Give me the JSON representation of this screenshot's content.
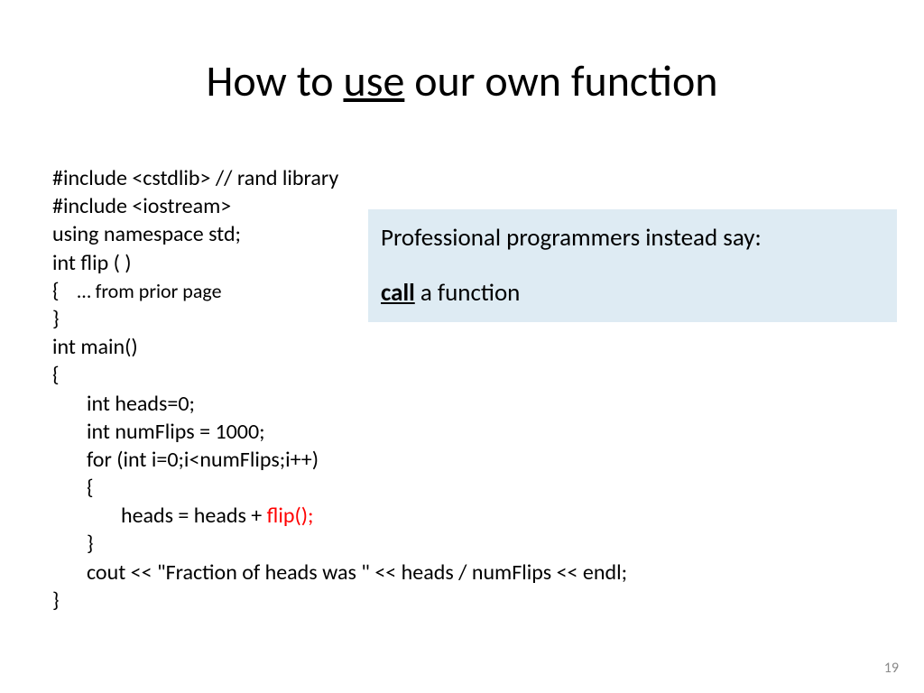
{
  "title": {
    "pre": "How to ",
    "underlined": "use",
    "post": " our own function"
  },
  "code": {
    "l1": "#include <cstdlib> // rand library",
    "l2": "#include <iostream>",
    "l3": "using namespace std;",
    "l4": "int flip ( )",
    "l5_open": "{",
    "l5_note": "    … from prior page",
    "l6": "}",
    "l7": "int main()",
    "l8": "{",
    "l9": "       int heads=0;",
    "l10": "       int numFlips = 1000;",
    "l11": "       for (int i=0;i<numFlips;i++)",
    "l12": "       {",
    "l13_pre": "              heads = heads + ",
    "l13_red": "flip();",
    "l14": "       }",
    "l15": "       cout << \"Fraction of heads was \" << heads / numFlips << endl;",
    "l16": "}"
  },
  "callout": {
    "line1": "Professional programmers instead say:",
    "strong": "call",
    "rest": " a function"
  },
  "pageNumber": "19"
}
